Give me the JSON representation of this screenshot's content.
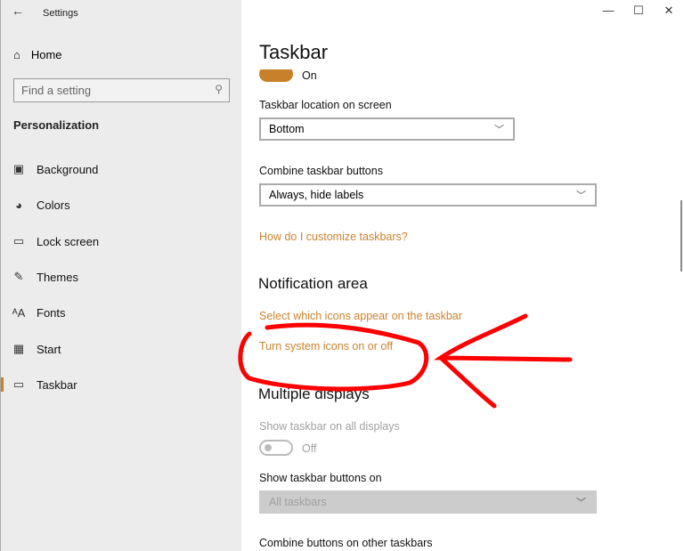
{
  "window": {
    "title": "Settings",
    "back": "←",
    "minimize": "—",
    "maximize": "☐",
    "close": "✕"
  },
  "sidebar": {
    "home": "Home",
    "search_placeholder": "Find a setting",
    "section": "Personalization",
    "items": [
      {
        "label": "Background",
        "icon": "▣"
      },
      {
        "label": "Colors",
        "icon": "◕"
      },
      {
        "label": "Lock screen",
        "icon": "▭"
      },
      {
        "label": "Themes",
        "icon": "✎"
      },
      {
        "label": "Fonts",
        "icon": "ᴬA"
      },
      {
        "label": "Start",
        "icon": "▦"
      },
      {
        "label": "Taskbar",
        "icon": "▭"
      }
    ]
  },
  "main": {
    "title": "Taskbar",
    "toggle_on_label": "On",
    "location_label": "Taskbar location on screen",
    "location_value": "Bottom",
    "combine_label": "Combine taskbar buttons",
    "combine_value": "Always, hide labels",
    "customize_link": "How do I customize taskbars?",
    "notification_heading": "Notification area",
    "select_icons_link": "Select which icons appear on the taskbar",
    "system_icons_link": "Turn system icons on or off",
    "multi_heading": "Multiple displays",
    "show_all_label": "Show taskbar on all displays",
    "show_all_value": "Off",
    "show_buttons_label": "Show taskbar buttons on",
    "show_buttons_value": "All taskbars",
    "combine_other_label": "Combine buttons on other taskbars"
  },
  "colors": {
    "accent": "#c8812a",
    "annotation": "#ff0000"
  }
}
